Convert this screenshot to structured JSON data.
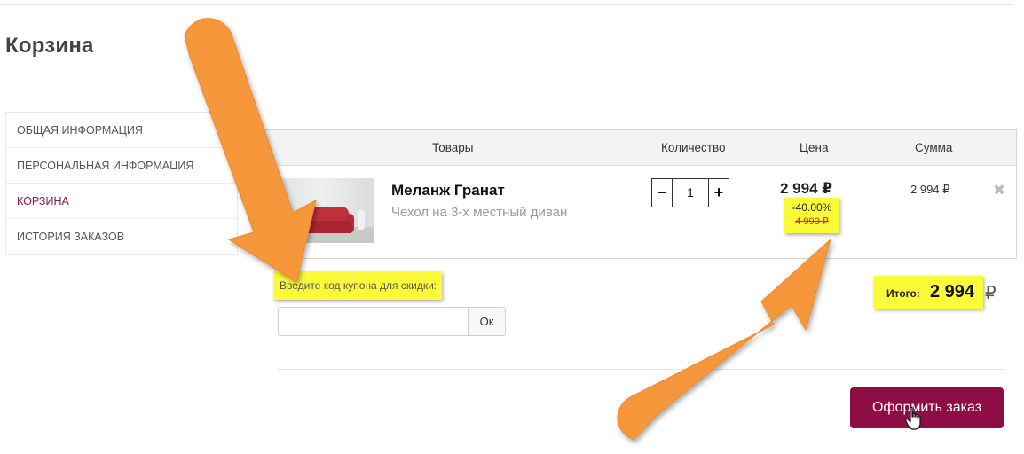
{
  "page": {
    "title": "Корзина"
  },
  "sidebar": {
    "items": [
      {
        "label": "ОБЩАЯ ИНФОРМАЦИЯ"
      },
      {
        "label": "ПЕРСОНАЛЬНАЯ ИНФОРМАЦИЯ"
      },
      {
        "label": "КОРЗИНА"
      },
      {
        "label": "ИСТОРИЯ ЗАКАЗОВ"
      }
    ],
    "active_index": 2,
    "active_color": "#8a1a4a"
  },
  "cart": {
    "columns": {
      "goods": "Товары",
      "qty": "Количество",
      "price": "Цена",
      "sum": "Сумма"
    },
    "item": {
      "name": "Меланж Гранат",
      "description": "Чехол на 3-х местный диван",
      "quantity": "1",
      "minus": "−",
      "plus": "+",
      "price": "2 994 ₽",
      "discount": "-40.00%",
      "old_price": "4 990 ₽",
      "sum": "2 994 ₽",
      "remove_icon": "✖"
    }
  },
  "coupon": {
    "label": "Введите код купона для скидки:",
    "placeholder": "",
    "button": "Ок"
  },
  "total": {
    "label": "Итого:",
    "value": "2 994",
    "currency": "₽"
  },
  "checkout": {
    "button": "Оформить заказ",
    "color": "#8f0d45"
  },
  "colors": {
    "highlight": "#fbfb3a",
    "arrow": "#f7973a"
  }
}
